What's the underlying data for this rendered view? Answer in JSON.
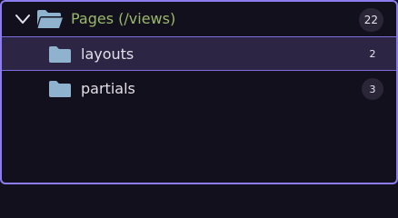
{
  "explorer": {
    "group": {
      "label": "Pages (/views)",
      "count": "22",
      "icon": "folder-open-icon",
      "expanded": true
    },
    "items": [
      {
        "label": "layouts",
        "count": "2",
        "icon": "folder-icon",
        "selected": true
      },
      {
        "label": "partials",
        "count": "3",
        "icon": "folder-icon",
        "selected": false
      }
    ]
  },
  "colors": {
    "border": "#8b7cf0",
    "background": "#13101d",
    "selected_background": "#2d2544",
    "folder": "#8fb3cf",
    "group_label": "#9ab86a",
    "item_label": "#e2dfe8",
    "badge_background": "#2a2637"
  }
}
